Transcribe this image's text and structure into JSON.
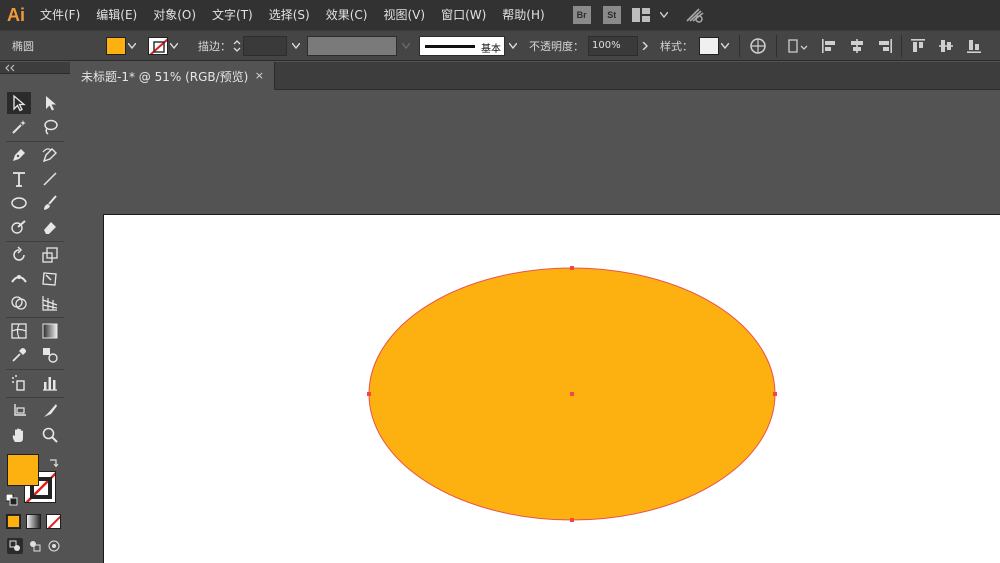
{
  "app": {
    "logo": "Ai"
  },
  "menu": {
    "items": [
      "文件(F)",
      "编辑(E)",
      "对象(O)",
      "文字(T)",
      "选择(S)",
      "效果(C)",
      "视图(V)",
      "窗口(W)",
      "帮助(H)"
    ],
    "badge_br": "Br",
    "badge_st": "St"
  },
  "control": {
    "object_type": "椭圆",
    "fill_color": "#fdb111",
    "stroke_label": "描边：",
    "profile_label": "基本",
    "opacity_label": "不透明度：",
    "opacity_value": "100%",
    "style_label": "样式："
  },
  "document": {
    "tab_title": "未标题-1* @ 51% (RGB/预览)",
    "close_glyph": "×"
  },
  "colors": {
    "fill": "#fdb111",
    "stroke": "#e8534b",
    "selection": "#f04848",
    "ui_dark": "#323232",
    "ui_mid": "#454545",
    "ui_canvas": "#535353"
  },
  "tools": [
    "selection-tool",
    "direct-selection-tool",
    "magic-wand-tool",
    "lasso-tool",
    "pen-tool",
    "curvature-tool",
    "type-tool",
    "line-segment-tool",
    "ellipse-tool",
    "paintbrush-tool",
    "shaper-tool",
    "eraser-tool",
    "rotate-tool",
    "scale-tool",
    "width-tool",
    "free-transform-tool",
    "shape-builder-tool",
    "perspective-grid-tool",
    "mesh-tool",
    "gradient-tool",
    "eyedropper-tool",
    "blend-tool",
    "symbol-sprayer-tool",
    "column-graph-tool",
    "artboard-tool",
    "slice-tool",
    "hand-tool",
    "zoom-tool"
  ]
}
